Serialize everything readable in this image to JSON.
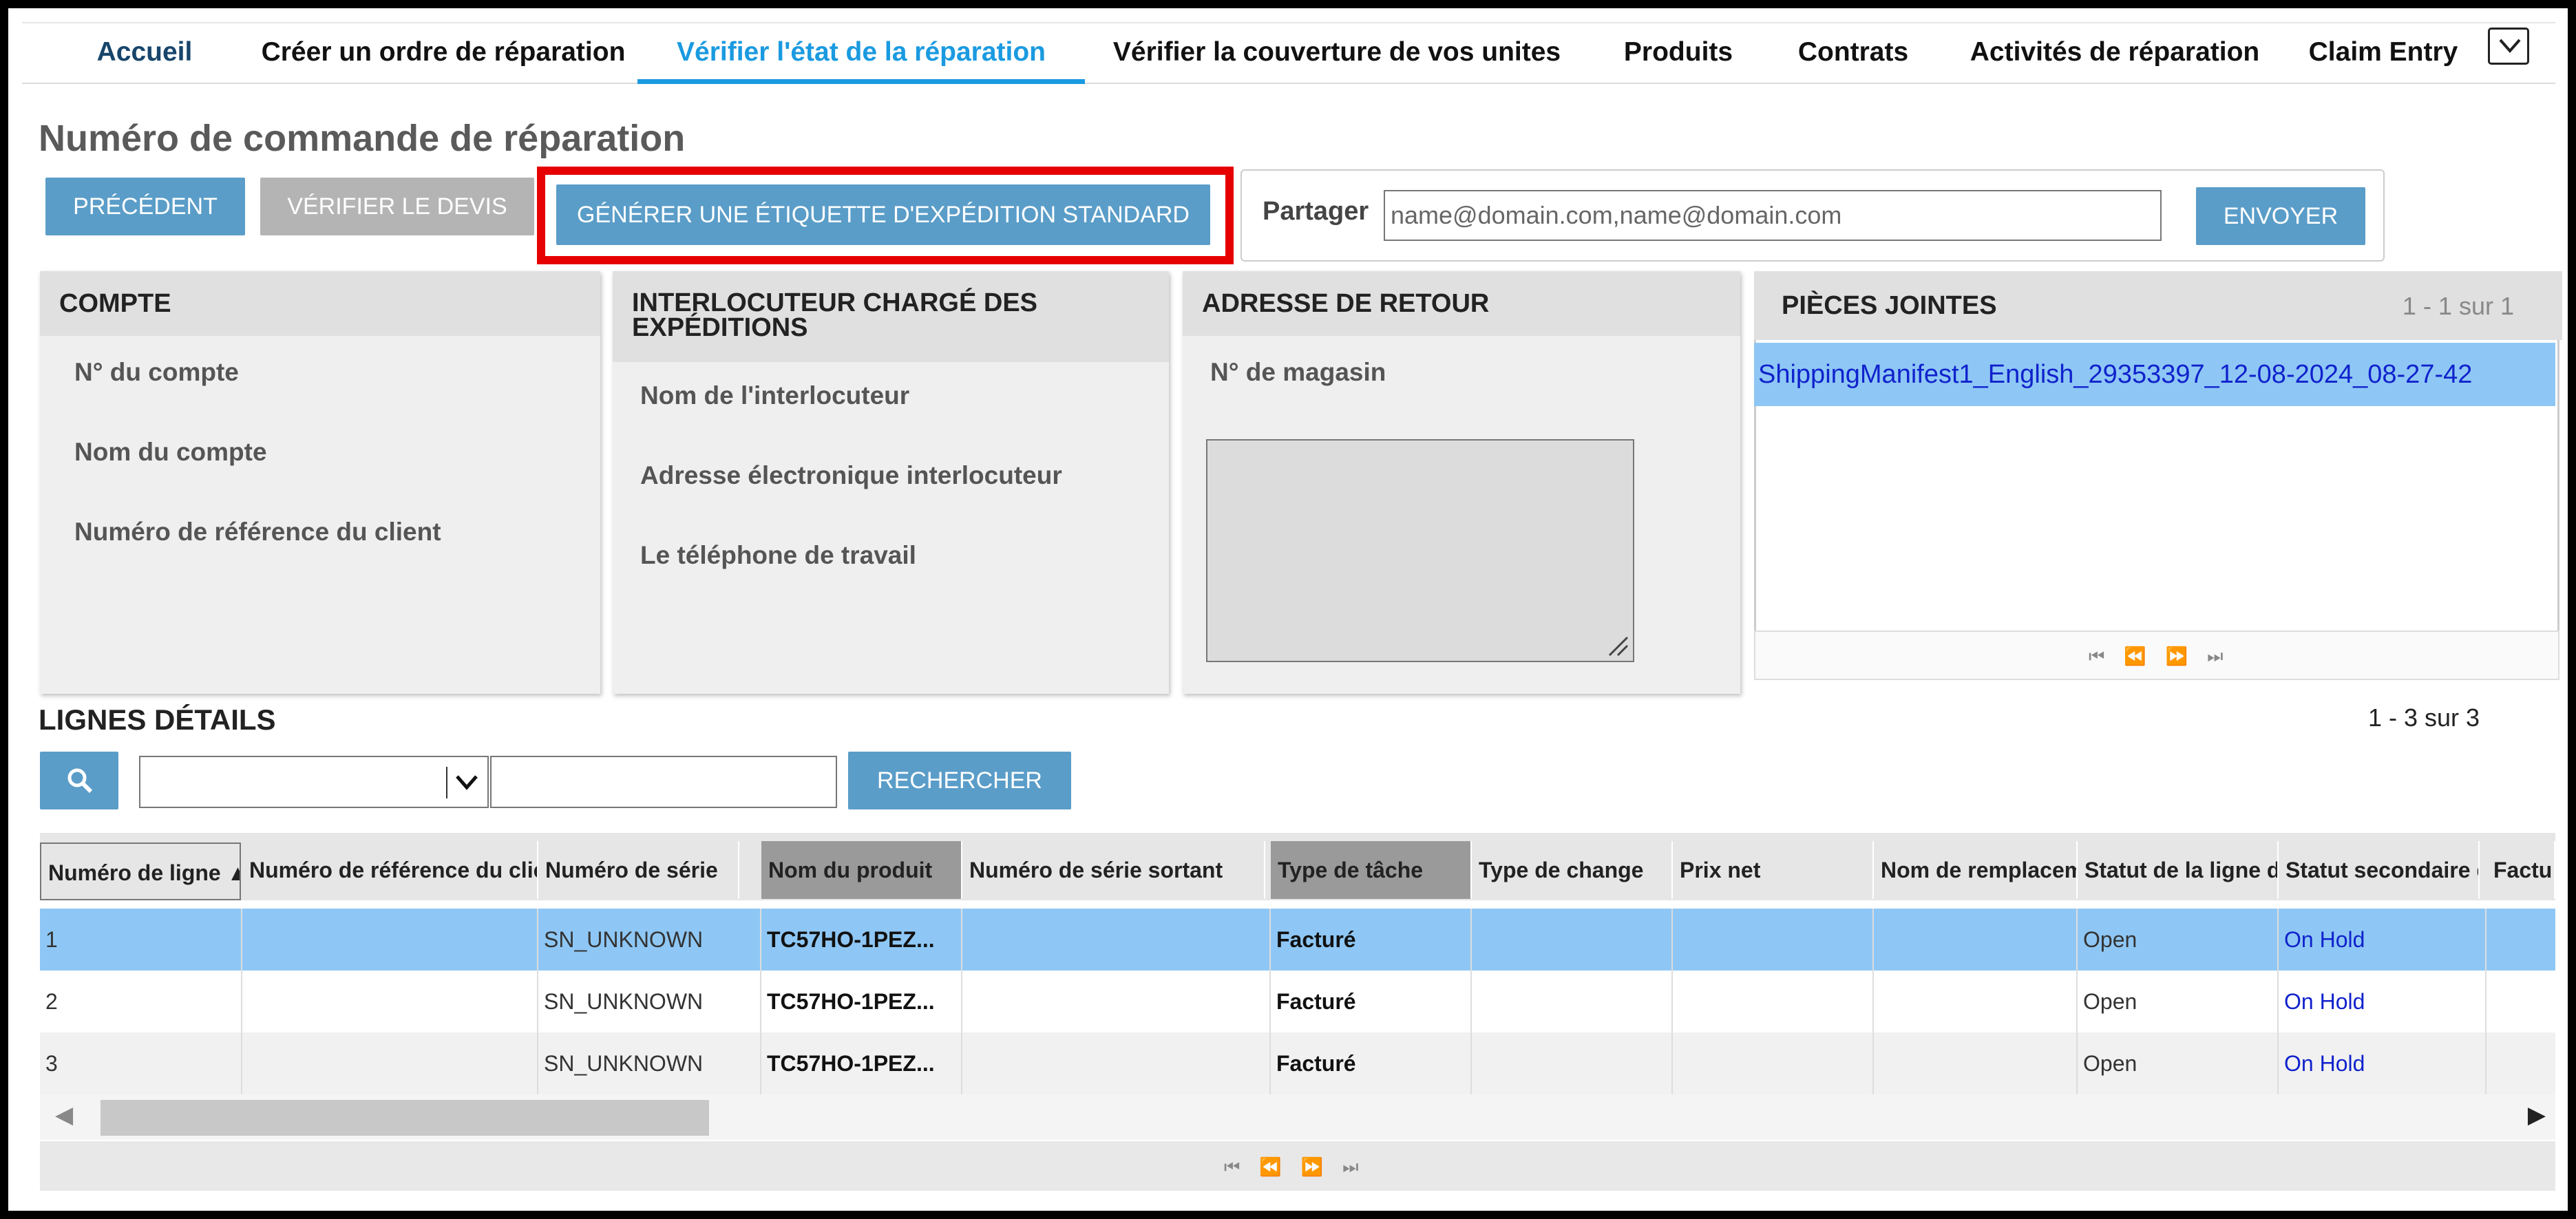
{
  "nav": {
    "tabs": [
      {
        "label": "Accueil"
      },
      {
        "label": "Créer un ordre de réparation"
      },
      {
        "label": "Vérifier l'état de la réparation"
      },
      {
        "label": "Vérifier la couverture de vos unites"
      },
      {
        "label": "Produits"
      },
      {
        "label": "Contrats"
      },
      {
        "label": "Activités de réparation"
      },
      {
        "label": "Claim Entry"
      }
    ],
    "active_tab": "Vérifier l'état de la réparation",
    "more_icon": "chevron-down-icon"
  },
  "page_title": "Numéro de commande de réparation",
  "toolbar": {
    "prev_label": "PRÉCÉDENT",
    "quote_label": "VÉRIFIER LE DEVIS",
    "shipping_label": "GÉNÉRER UNE ÉTIQUETTE D'EXPÉDITION STANDARD"
  },
  "share": {
    "label": "Partager",
    "placeholder": "name@domain.com,name@domain.com",
    "send_label": "ENVOYER"
  },
  "panels": {
    "account": {
      "title": "COMPTE",
      "fields": [
        "N° du compte",
        "Nom du compte",
        "Numéro de référence du client"
      ]
    },
    "contact": {
      "title": "INTERLOCUTEUR CHARGÉ DES EXPÉDITIONS",
      "fields": [
        "Nom de l'interlocuteur",
        "Adresse électronique interlocuteur",
        "Le téléphone de travail"
      ]
    },
    "return_address": {
      "title": "ADRESSE DE RETOUR",
      "fields": [
        "N° de magasin"
      ]
    },
    "attachments": {
      "title": "PIÈCES JOINTES",
      "count": "1 - 1 sur 1",
      "items": [
        "ShippingManifest1_English_29353397_12-08-2024_08-27-42"
      ]
    }
  },
  "lines": {
    "title": "LIGNES DÉTAILS",
    "count": "1 - 3 sur 3",
    "search_label": "RECHERCHER",
    "columns": [
      "Numéro de ligne",
      "Numéro de référence du client",
      "Numéro de série",
      "Nom du produit",
      "Numéro de série sortant",
      "Type de tâche",
      "Type de change",
      "Prix net",
      "Nom de remplacement",
      "Statut de la ligne de",
      "Statut secondaire de",
      "Factu"
    ],
    "rows": [
      {
        "line": "1",
        "ref": "",
        "serial": "SN_UNKNOWN",
        "product": "TC57HO-1PEZ...",
        "serial_out": "",
        "task": "Facturé",
        "exchange": "",
        "price": "",
        "replacement": "",
        "status": "Open",
        "substatus": "On Hold"
      },
      {
        "line": "2",
        "ref": "",
        "serial": "SN_UNKNOWN",
        "product": "TC57HO-1PEZ...",
        "serial_out": "",
        "task": "Facturé",
        "exchange": "",
        "price": "",
        "replacement": "",
        "status": "Open",
        "substatus": "On Hold"
      },
      {
        "line": "3",
        "ref": "",
        "serial": "SN_UNKNOWN",
        "product": "TC57HO-1PEZ...",
        "serial_out": "",
        "task": "Facturé",
        "exchange": "",
        "price": "",
        "replacement": "",
        "status": "Open",
        "substatus": "On Hold"
      }
    ]
  },
  "colors": {
    "accent": "#1a9ae0",
    "button": "#5a9dc8",
    "highlight": "#e60000",
    "selected_row": "#8ec7f5"
  }
}
